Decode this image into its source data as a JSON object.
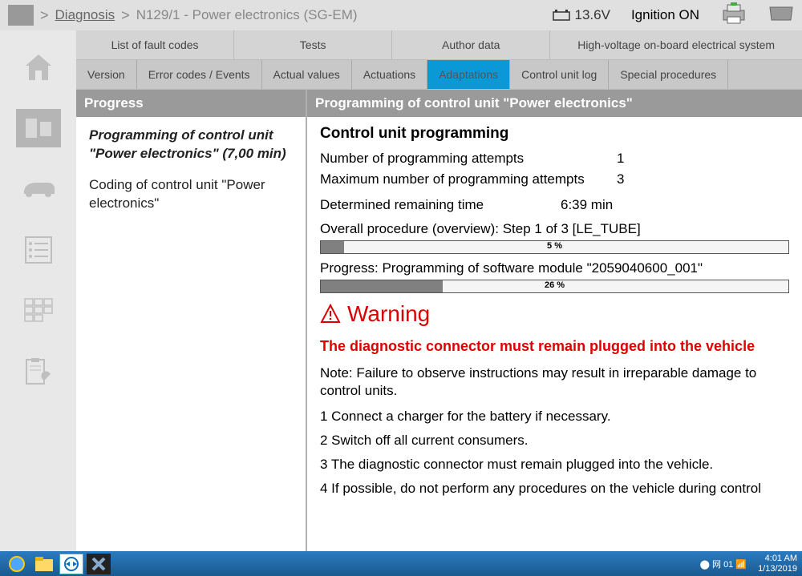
{
  "topbar": {
    "breadcrumb_link": "Diagnosis",
    "breadcrumb_current": "N129/1 - Power electronics (SG-EM)",
    "voltage": "13.6V",
    "ignition": "Ignition ON"
  },
  "tabs_row1": {
    "fault_codes": "List of fault codes",
    "tests": "Tests",
    "author_data": "Author data",
    "hv_system": "High-voltage on-board electrical system"
  },
  "tabs_row2": {
    "version": "Version",
    "error_codes": "Error codes / Events",
    "actual_values": "Actual values",
    "actuations": "Actuations",
    "adaptations": "Adaptations",
    "control_unit_log": "Control unit log",
    "special_procedures": "Special procedures"
  },
  "left_panel": {
    "header": "Progress",
    "item1": "Programming of control unit \"Power electronics\" (7,00 min)",
    "item2": "Coding of control unit \"Power electronics\""
  },
  "right_panel": {
    "header": "Programming of control unit \"Power electronics\"",
    "section_title": "Control unit programming",
    "attempts_label": "Number of programming attempts",
    "attempts_value": "1",
    "max_attempts_label": "Maximum number of programming attempts",
    "max_attempts_value": "3",
    "remaining_label": "Determined remaining time",
    "remaining_value": "6:39 min",
    "overview": "Overall procedure (overview): Step 1 of 3 [LE_TUBE]",
    "overview_pct": "5 %",
    "progress_line": "Progress:  Programming of software module \"2059040600_001\"",
    "progress_pct": "26 %",
    "warning_title": "Warning",
    "warning_sub": "The diagnostic connector must remain plugged into the vehicle",
    "note": "Note: Failure to observe instructions may result in irreparable damage to control units.",
    "step1": "1 Connect a charger for the battery if necessary.",
    "step2": "2 Switch off all current consumers.",
    "step3": "3 The diagnostic connector must remain plugged into the vehicle.",
    "step4": "4 If possible, do not perform any procedures on the vehicle during control"
  },
  "taskbar": {
    "time": "4:01 AM",
    "date": "1/13/2019",
    "tray_text": "⬤ 网 01 📶"
  },
  "progress_values": {
    "overview_fill": "5%",
    "module_fill": "26%"
  }
}
